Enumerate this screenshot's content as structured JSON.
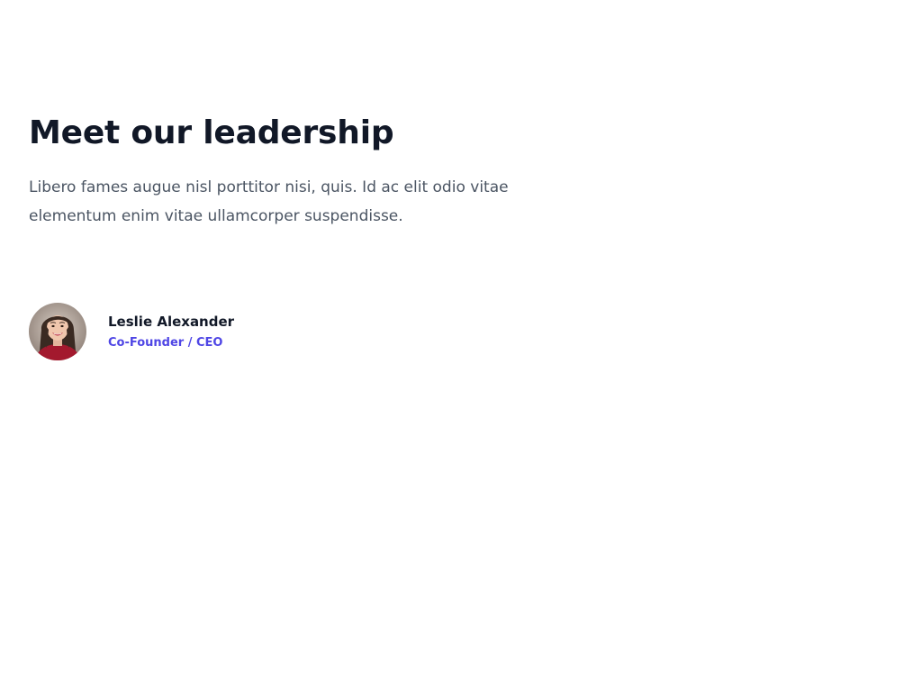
{
  "section": {
    "title": "Meet our leadership",
    "description": "Libero fames augue nisl porttitor nisi, quis. Id ac elit odio vitae elementum enim vitae ullamcorper suspendisse."
  },
  "people": [
    {
      "name": "Leslie Alexander",
      "role": "Co-Founder / CEO",
      "avatar_icon": "portrait-photo"
    }
  ],
  "colors": {
    "heading": "#111827",
    "body_text": "#4b5563",
    "accent": "#4f46e5",
    "background": "#ffffff"
  }
}
